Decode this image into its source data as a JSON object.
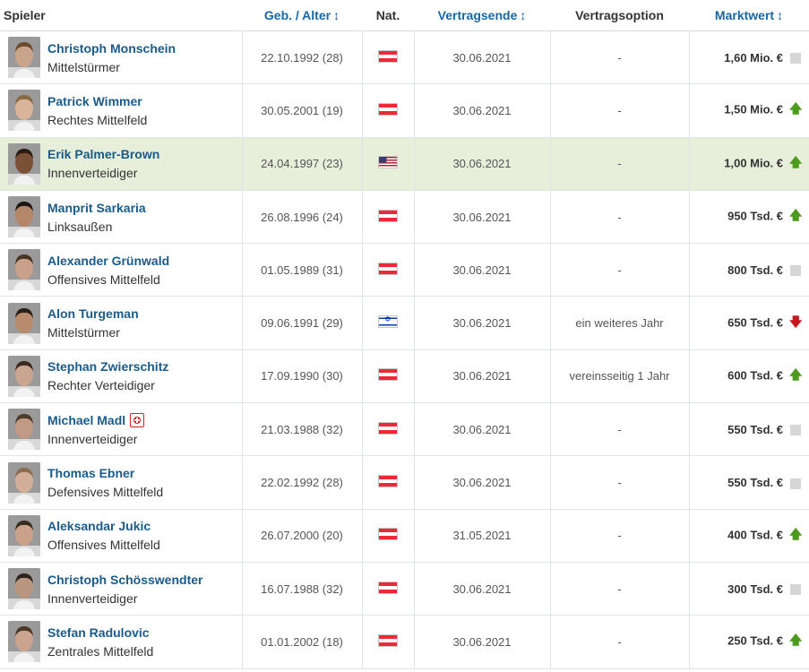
{
  "columns": {
    "player": "Spieler",
    "birth": "Geb. / Alter",
    "nat": "Nat.",
    "contract_end": "Vertragsende",
    "option": "Vertragsoption",
    "market_value": "Marktwert",
    "sort_glyph": "↕"
  },
  "players": [
    {
      "name": "Christoph Monschein",
      "position": "Mittelstürmer",
      "birth": "22.10.1992 (28)",
      "nation": "Austria",
      "flag": "aut",
      "contract_end": "30.06.2021",
      "option": "-",
      "value": "1,60 Mio. €",
      "trend": "same",
      "injured": false,
      "skin": "#c8a58a",
      "hair": "#6b4a2e"
    },
    {
      "name": "Patrick Wimmer",
      "position": "Rechtes Mittelfeld",
      "birth": "30.05.2001 (19)",
      "nation": "Austria",
      "flag": "aut",
      "contract_end": "30.06.2021",
      "option": "-",
      "value": "1,50 Mio. €",
      "trend": "up",
      "injured": false,
      "skin": "#d9b39a",
      "hair": "#8a6a45"
    },
    {
      "name": "Erik Palmer-Brown",
      "position": "Innenverteidiger",
      "birth": "24.04.1997 (23)",
      "nation": "United States",
      "flag": "usa",
      "contract_end": "30.06.2021",
      "option": "-",
      "value": "1,00 Mio. €",
      "trend": "up",
      "injured": false,
      "skin": "#7a5136",
      "hair": "#2a1a10"
    },
    {
      "name": "Manprit Sarkaria",
      "position": "Linksaußen",
      "birth": "26.08.1996 (24)",
      "nation": "Austria",
      "flag": "aut",
      "contract_end": "30.06.2021",
      "option": "-",
      "value": "950 Tsd. €",
      "trend": "up",
      "injured": false,
      "skin": "#b5876a",
      "hair": "#1e1612"
    },
    {
      "name": "Alexander Grünwald",
      "position": "Offensives Mittelfeld",
      "birth": "01.05.1989 (31)",
      "nation": "Austria",
      "flag": "aut",
      "contract_end": "30.06.2021",
      "option": "-",
      "value": "800 Tsd. €",
      "trend": "same",
      "injured": false,
      "skin": "#c9a08a",
      "hair": "#4a3424"
    },
    {
      "name": "Alon Turgeman",
      "position": "Mittelstürmer",
      "birth": "09.06.1991 (29)",
      "nation": "Israel",
      "flag": "isr",
      "contract_end": "30.06.2021",
      "option": "ein weiteres Jahr",
      "value": "650 Tsd. €",
      "trend": "down",
      "injured": false,
      "skin": "#b88c6c",
      "hair": "#2b2018"
    },
    {
      "name": "Stephan Zwierschitz",
      "position": "Rechter Verteidiger",
      "birth": "17.09.1990 (30)",
      "nation": "Austria",
      "flag": "aut",
      "contract_end": "30.06.2021",
      "option": "vereinsseitig 1 Jahr",
      "value": "600 Tsd. €",
      "trend": "up",
      "injured": false,
      "skin": "#c9a48e",
      "hair": "#3a2a20"
    },
    {
      "name": "Michael Madl",
      "position": "Innenverteidiger",
      "birth": "21.03.1988 (32)",
      "nation": "Austria",
      "flag": "aut",
      "contract_end": "30.06.2021",
      "option": "-",
      "value": "550 Tsd. €",
      "trend": "same",
      "injured": true,
      "skin": "#c09a84",
      "hair": "#4d3b2d"
    },
    {
      "name": "Thomas Ebner",
      "position": "Defensives Mittelfeld",
      "birth": "22.02.1992 (28)",
      "nation": "Austria",
      "flag": "aut",
      "contract_end": "30.06.2021",
      "option": "-",
      "value": "550 Tsd. €",
      "trend": "same",
      "injured": false,
      "skin": "#d2ae98",
      "hair": "#8a6c4e"
    },
    {
      "name": "Aleksandar Jukic",
      "position": "Offensives Mittelfeld",
      "birth": "26.07.2000 (20)",
      "nation": "Austria",
      "flag": "aut",
      "contract_end": "31.05.2021",
      "option": "-",
      "value": "400 Tsd. €",
      "trend": "up",
      "injured": false,
      "skin": "#caa28a",
      "hair": "#3b2c22"
    },
    {
      "name": "Christoph Schösswendter",
      "position": "Innenverteidiger",
      "birth": "16.07.1988 (32)",
      "nation": "Austria",
      "flag": "aut",
      "contract_end": "30.06.2021",
      "option": "-",
      "value": "300 Tsd. €",
      "trend": "same",
      "injured": false,
      "skin": "#b99680",
      "hair": "#2e241d"
    },
    {
      "name": "Stefan Radulovic",
      "position": "Zentrales Mittelfeld",
      "birth": "01.01.2002 (18)",
      "nation": "Austria",
      "flag": "aut",
      "contract_end": "30.06.2021",
      "option": "-",
      "value": "250 Tsd. €",
      "trend": "up",
      "injured": false,
      "skin": "#caa48e",
      "hair": "#4a3728"
    }
  ],
  "highlight_row": 2,
  "colors": {
    "link": "#1a5b8a",
    "header_link": "#1a66a3",
    "highlight_bg": "#e7efdb",
    "trend_up": "#4c9a1e",
    "trend_down": "#c8161d"
  }
}
